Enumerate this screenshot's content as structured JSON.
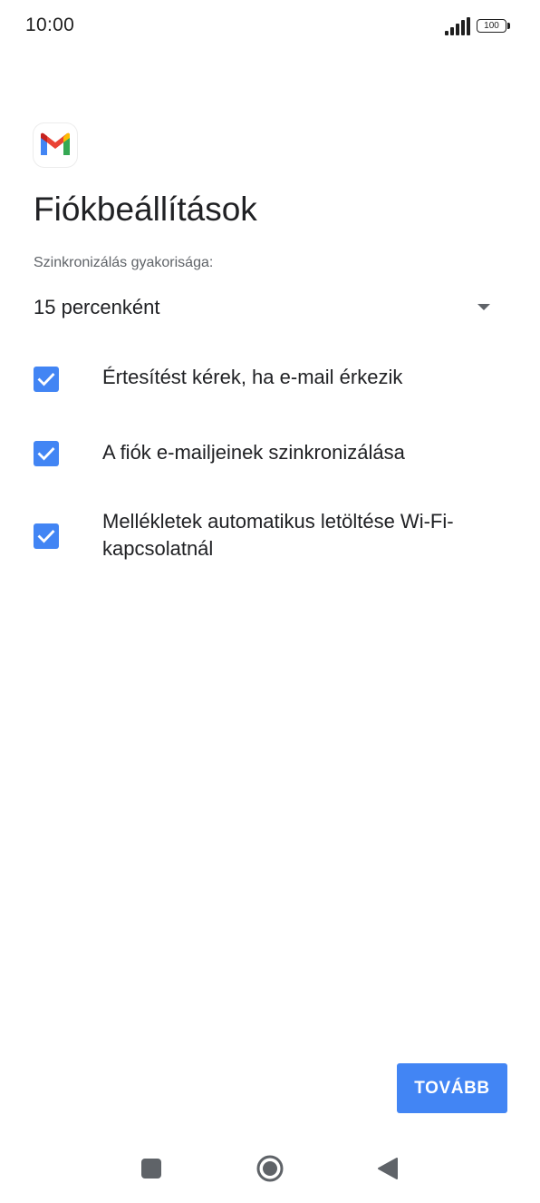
{
  "status_bar": {
    "time": "10:00",
    "battery_level": "100",
    "signal_icon": "signal-bars-icon",
    "battery_icon": "battery-icon"
  },
  "app": {
    "logo_icon": "gmail-logo-icon"
  },
  "page": {
    "title": "Fiókbeállítások",
    "sync_label": "Szinkronizálás gyakorisága:",
    "sync_value": "15 percenként"
  },
  "options": [
    {
      "label": "Értesítést kérek, ha e-mail érkezik",
      "checked": true
    },
    {
      "label": "A fiók e-mailjeinek szinkronizálása",
      "checked": true
    },
    {
      "label": "Mellékletek automatikus letöltése Wi-Fi-kapcsolatnál",
      "checked": true
    }
  ],
  "actions": {
    "next_label": "TOVÁBB"
  },
  "colors": {
    "accent": "#4285f4",
    "text_primary": "#202124",
    "text_secondary": "#5f6368"
  },
  "nav_bar": {
    "recents_icon": "square-recents-icon",
    "home_icon": "circle-home-icon",
    "back_icon": "triangle-back-icon"
  }
}
